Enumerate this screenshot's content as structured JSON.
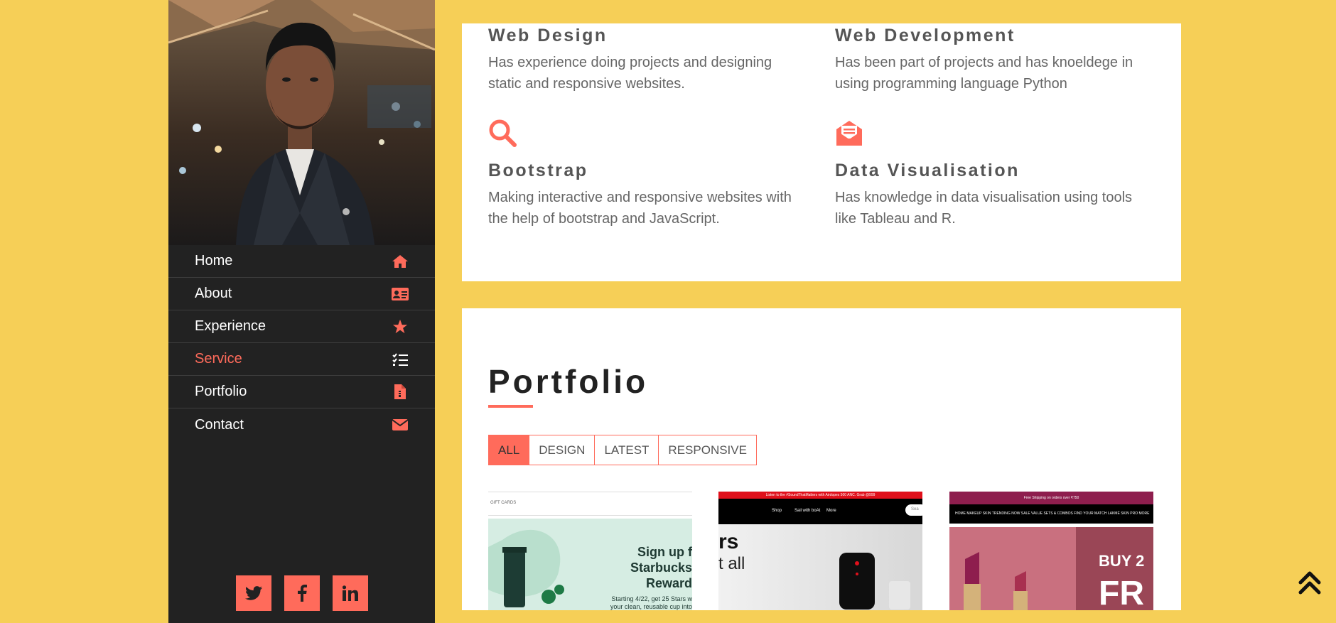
{
  "nav": {
    "items": [
      {
        "label": "Home",
        "icon": "home-icon"
      },
      {
        "label": "About",
        "icon": "id-card-icon"
      },
      {
        "label": "Experience",
        "icon": "star-icon"
      },
      {
        "label": "Service",
        "icon": "task-list-icon"
      },
      {
        "label": "Portfolio",
        "icon": "file-icon"
      },
      {
        "label": "Contact",
        "icon": "envelope-icon"
      }
    ],
    "active": "Service"
  },
  "social": [
    "twitter-icon",
    "facebook-icon",
    "linkedin-icon"
  ],
  "services": [
    {
      "title": "Web Design",
      "desc": "Has experience doing projects and designing static and responsive websites."
    },
    {
      "title": "Web Development",
      "desc": "Has been part of projects and has knoeldege in using programming language Python"
    },
    {
      "title": "Bootstrap",
      "desc": "Making interactive and responsive websites with the help of bootstrap and JavaScript.",
      "icon": "search-icon"
    },
    {
      "title": "Data Visualisation",
      "desc": "Has knowledge in data visualisation using tools like Tableau and R.",
      "icon": "envelope-open-icon"
    }
  ],
  "portfolio": {
    "title": "Portfolio",
    "filters": [
      "ALL",
      "DESIGN",
      "LATEST",
      "RESPONSIVE"
    ],
    "active_filter": "ALL",
    "thumbs": [
      {
        "header": "GIFT CARDS",
        "headline": "Sign up f",
        "line2": "Starbucks",
        "line3": "Reward",
        "small": "Starting 4/22, get 25 Stars w",
        "small2": "your clean, reusable cup into"
      },
      {
        "banner": "Listen to the #SoundThatMatters with Airdopes 500 ANC. Grab @999",
        "menu1": "Shop",
        "menu2": "Sail with boAt",
        "menu3": "More",
        "search": "Sea",
        "big1": "rs",
        "big2": "t all"
      },
      {
        "banner": "Free Shipping on orders over ₹750",
        "menu": "HOME  MAKEUP  SKIN  TRENDING NOW  SALE  VALUE SETS & COMBOS  FIND YOUR MATCH  LAKMÉ SKIN PRO  MORE",
        "big1": "BUY 2",
        "big2": "FR"
      }
    ]
  },
  "colors": {
    "accent": "#ff6b5b",
    "background": "#f6cf57",
    "sidebar": "#222222"
  }
}
